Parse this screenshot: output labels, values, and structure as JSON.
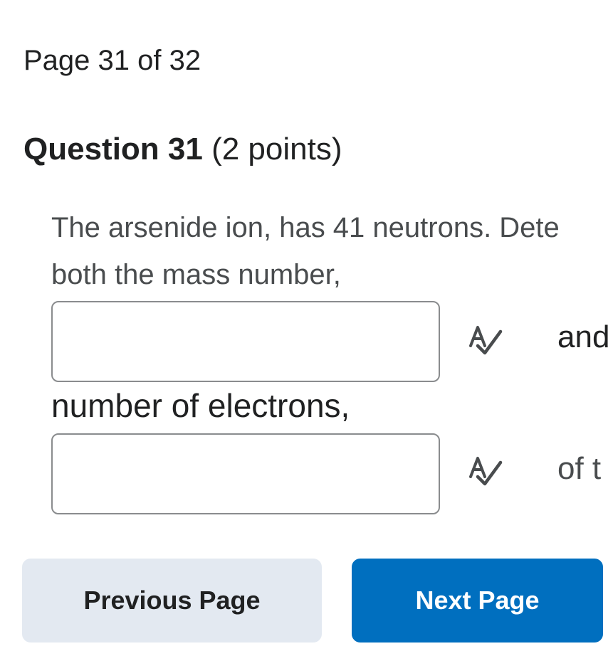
{
  "page_indicator": "Page 31 of 32",
  "question": {
    "title": "Question 31",
    "points": "(2 points)",
    "prompt_line1": "The arsenide ion, has 41 neutrons. Dete",
    "prompt_line2": "both the mass number,",
    "after_input1": "and",
    "middle_text": "number of electrons,",
    "after_input2": "of t",
    "input1": {
      "value": "",
      "placeholder": ""
    },
    "input2": {
      "value": "",
      "placeholder": ""
    },
    "spellcheck_icon": "spell-check-icon"
  },
  "nav": {
    "previous_label": "Previous Page",
    "next_label": "Next Page"
  },
  "colors": {
    "primary": "#006fbf",
    "secondary_bg": "#e3e9f1",
    "text": "#202122",
    "muted_text": "#494c4e",
    "input_border": "#8a8c8e"
  }
}
